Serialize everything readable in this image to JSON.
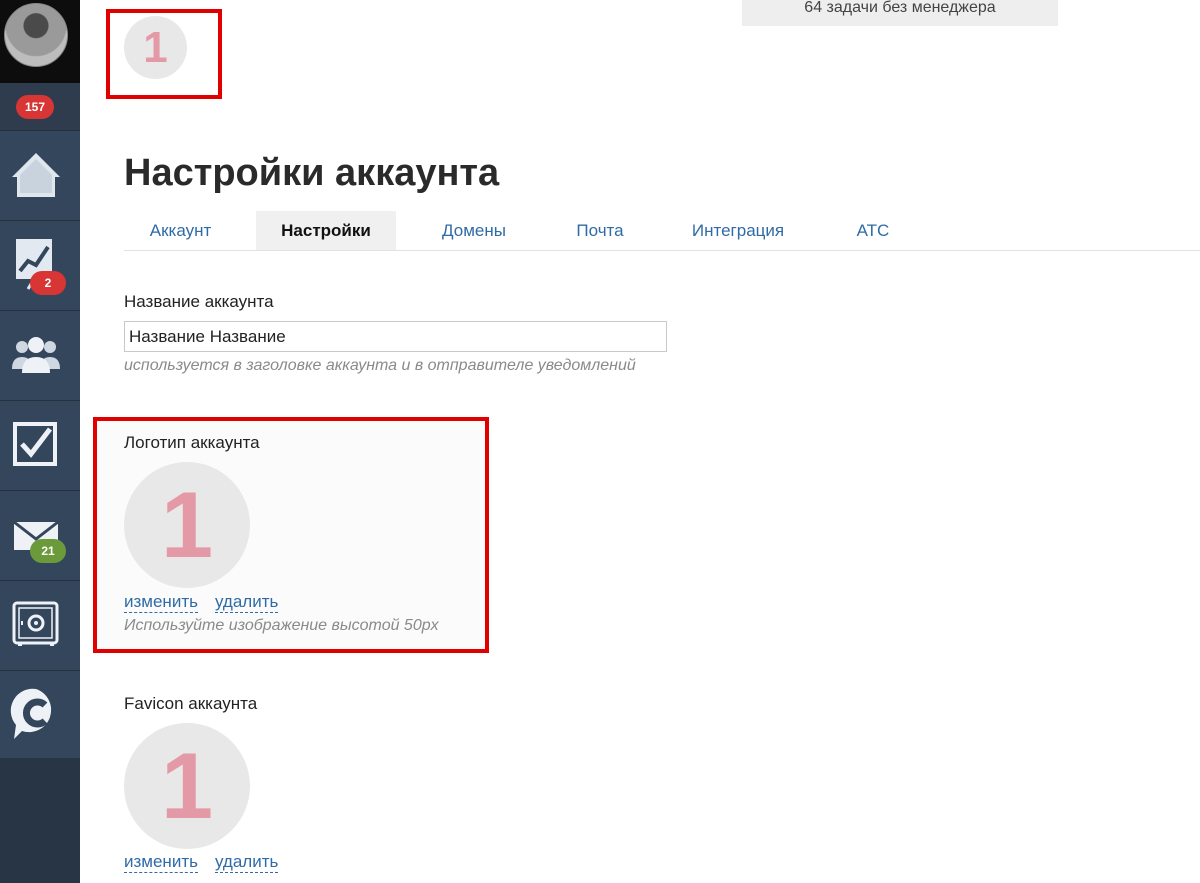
{
  "header": {
    "logo_text": "1",
    "tasks_notice": "64 задачи без менеджера"
  },
  "sidebar": {
    "notifications_count": "157",
    "items": [
      {
        "name": "home",
        "icon": "home-icon",
        "badge": ""
      },
      {
        "name": "analytics",
        "icon": "chart-icon",
        "badge": "2"
      },
      {
        "name": "contacts",
        "icon": "users-icon",
        "badge": ""
      },
      {
        "name": "tasks",
        "icon": "checkbox-icon",
        "badge": ""
      },
      {
        "name": "mail",
        "icon": "mail-icon",
        "badge": "21"
      },
      {
        "name": "settings",
        "icon": "safe-icon",
        "badge": ""
      },
      {
        "name": "chat",
        "icon": "chat-c-icon",
        "badge": ""
      }
    ]
  },
  "page": {
    "title": "Настройки аккаунта",
    "tabs": [
      {
        "label": "Аккаунт"
      },
      {
        "label": "Настройки"
      },
      {
        "label": "Домены"
      },
      {
        "label": "Почта"
      },
      {
        "label": "Интеграция"
      },
      {
        "label": "АТС"
      }
    ],
    "active_tab": "Настройки"
  },
  "account_name": {
    "label": "Название аккаунта",
    "value": "Название Название",
    "hint": "используется в заголовке аккаунта и в отправителе уведомлений"
  },
  "account_logo": {
    "label": "Логотип аккаунта",
    "image_text": "1",
    "change_label": "изменить",
    "delete_label": "удалить",
    "hint": "Используйте изображение высотой 50px"
  },
  "favicon": {
    "label": "Favicon аккаунта",
    "image_text": "1",
    "change_label": "изменить",
    "delete_label": "удалить"
  },
  "colors": {
    "sidebar_bg": "#34465c",
    "badge_red": "#d83535",
    "badge_green": "#6a9a3a",
    "link": "#2f6ba6",
    "highlight_frame": "#e00000"
  }
}
